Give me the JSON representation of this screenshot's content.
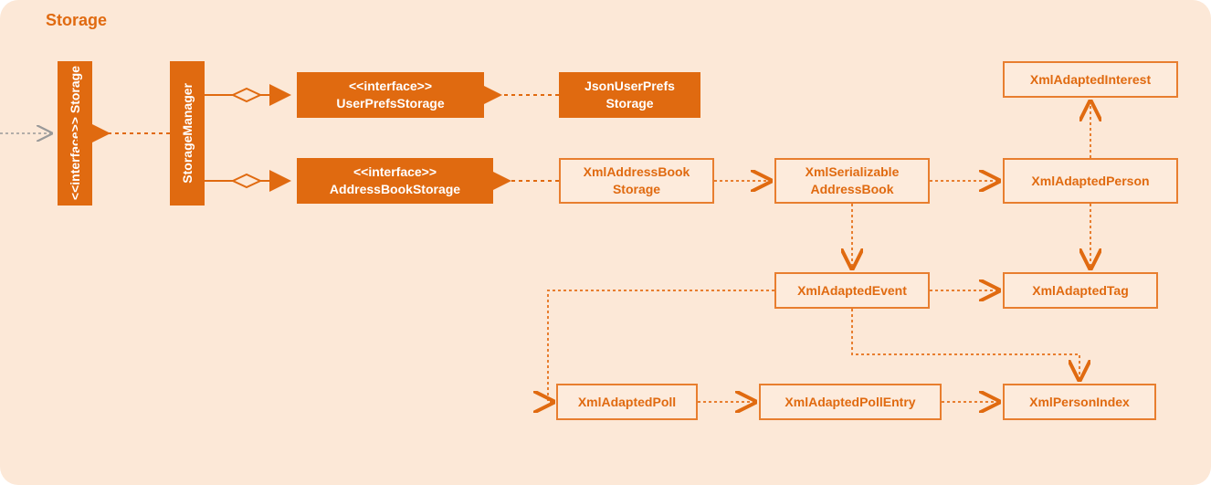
{
  "diagram": {
    "title": "Storage",
    "nodes": {
      "storageInterface": {
        "stereotype": "<<interface>>",
        "name": "Storage"
      },
      "storageManager": "StorageManager",
      "userPrefsStorage": {
        "stereotype": "<<interface>>",
        "name": "UserPrefsStorage"
      },
      "addressBookStorage": {
        "stereotype": "<<interface>>",
        "name": "AddressBookStorage"
      },
      "jsonUserPrefsStorage": "JsonUserPrefs Storage",
      "xmlAddressBookStorage": "XmlAddressBook Storage",
      "xmlSerializableAddressBook": "XmlSerializable AddressBook",
      "xmlAdaptedPerson": "XmlAdaptedPerson",
      "xmlAdaptedInterest": "XmlAdaptedInterest",
      "xmlAdaptedEvent": "XmlAdaptedEvent",
      "xmlAdaptedTag": "XmlAdaptedTag",
      "xmlAdaptedPoll": "XmlAdaptedPoll",
      "xmlAdaptedPollEntry": "XmlAdaptedPollEntry",
      "xmlPersonIndex": "XmlPersonIndex"
    }
  },
  "chart_data": {
    "type": "diagram",
    "title": "Storage",
    "nodes": [
      {
        "id": "Storage",
        "type": "interface",
        "style": "solid"
      },
      {
        "id": "StorageManager",
        "type": "class",
        "style": "solid"
      },
      {
        "id": "UserPrefsStorage",
        "type": "interface",
        "style": "solid"
      },
      {
        "id": "AddressBookStorage",
        "type": "interface",
        "style": "solid"
      },
      {
        "id": "JsonUserPrefsStorage",
        "type": "class",
        "style": "solid"
      },
      {
        "id": "XmlAddressBookStorage",
        "type": "class",
        "style": "light"
      },
      {
        "id": "XmlSerializableAddressBook",
        "type": "class",
        "style": "light"
      },
      {
        "id": "XmlAdaptedPerson",
        "type": "class",
        "style": "light"
      },
      {
        "id": "XmlAdaptedInterest",
        "type": "class",
        "style": "light"
      },
      {
        "id": "XmlAdaptedEvent",
        "type": "class",
        "style": "light"
      },
      {
        "id": "XmlAdaptedTag",
        "type": "class",
        "style": "light"
      },
      {
        "id": "XmlAdaptedPoll",
        "type": "class",
        "style": "light"
      },
      {
        "id": "XmlAdaptedPollEntry",
        "type": "class",
        "style": "light"
      },
      {
        "id": "XmlPersonIndex",
        "type": "class",
        "style": "light"
      }
    ],
    "edges": [
      {
        "from": "external",
        "to": "Storage",
        "type": "dependency-open"
      },
      {
        "from": "StorageManager",
        "to": "Storage",
        "type": "realization"
      },
      {
        "from": "StorageManager",
        "to": "UserPrefsStorage",
        "type": "aggregation"
      },
      {
        "from": "StorageManager",
        "to": "AddressBookStorage",
        "type": "aggregation"
      },
      {
        "from": "JsonUserPrefsStorage",
        "to": "UserPrefsStorage",
        "type": "realization"
      },
      {
        "from": "XmlAddressBookStorage",
        "to": "AddressBookStorage",
        "type": "realization"
      },
      {
        "from": "XmlAddressBookStorage",
        "to": "XmlSerializableAddressBook",
        "type": "dependency"
      },
      {
        "from": "XmlSerializableAddressBook",
        "to": "XmlAdaptedPerson",
        "type": "dependency"
      },
      {
        "from": "XmlSerializableAddressBook",
        "to": "XmlAdaptedEvent",
        "type": "dependency"
      },
      {
        "from": "XmlAdaptedPerson",
        "to": "XmlAdaptedInterest",
        "type": "dependency"
      },
      {
        "from": "XmlAdaptedPerson",
        "to": "XmlAdaptedTag",
        "type": "dependency"
      },
      {
        "from": "XmlAdaptedEvent",
        "to": "XmlAdaptedTag",
        "type": "dependency"
      },
      {
        "from": "XmlAdaptedEvent",
        "to": "XmlAdaptedPoll",
        "type": "dependency"
      },
      {
        "from": "XmlAdaptedEvent",
        "to": "XmlPersonIndex",
        "type": "dependency"
      },
      {
        "from": "XmlAdaptedPoll",
        "to": "XmlAdaptedPollEntry",
        "type": "dependency"
      },
      {
        "from": "XmlAdaptedPollEntry",
        "to": "XmlPersonIndex",
        "type": "dependency"
      }
    ]
  }
}
